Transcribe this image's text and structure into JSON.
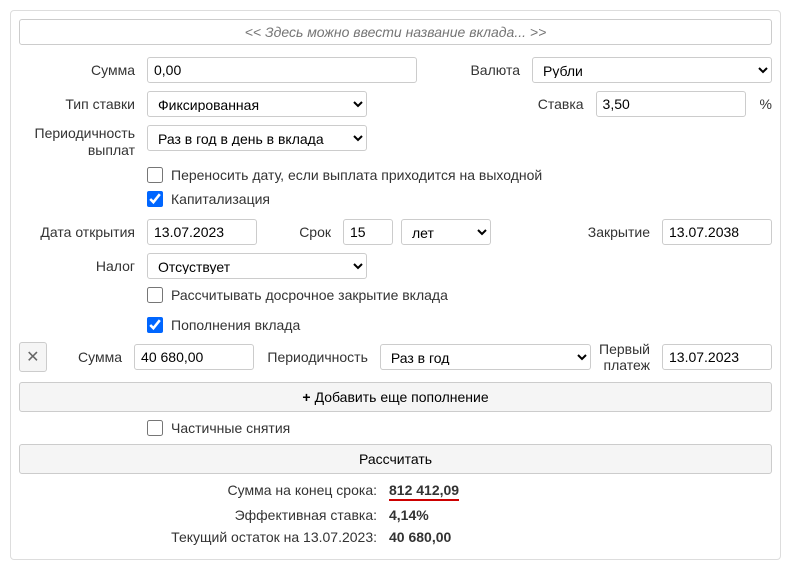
{
  "titlePlaceholder": "<< Здесь можно ввести название вклада... >>",
  "labels": {
    "amount": "Сумма",
    "currency": "Валюта",
    "rateType": "Тип ставки",
    "rate": "Ставка",
    "payoutFreq": "Периодичность выплат",
    "moveDate": "Переносить дату, если выплата приходится на выходной",
    "capitalization": "Капитализация",
    "openDate": "Дата открытия",
    "term": "Срок",
    "closeDate": "Закрытие",
    "tax": "Налог",
    "earlyClose": "Рассчитывать досрочное закрытие вклада",
    "refills": "Пополнения вклада",
    "refillAmount": "Сумма",
    "refillFreq": "Периодичность",
    "firstPayment": "Первый платеж",
    "addRefill": "Добавить еще пополнение",
    "withdrawals": "Частичные снятия",
    "calculate": "Рассчитать",
    "endAmount": "Сумма на конец срока:",
    "effRate": "Эффективная ставка:",
    "currentBalance": "Текущий остаток на 13.07.2023:",
    "pctSign": "%"
  },
  "values": {
    "amount": "0,00",
    "currency": "Рубли",
    "rateType": "Фиксированная",
    "rate": "3,50",
    "payoutFreq": "Раз в год в день в вклада",
    "openDate": "13.07.2023",
    "term": "15",
    "termUnit": "лет",
    "closeDate": "13.07.2038",
    "tax": "Отсуствует",
    "refillAmount": "40 680,00",
    "refillFreq": "Раз в год",
    "firstPaymentDate": "13.07.2023"
  },
  "checkboxes": {
    "moveDate": false,
    "capitalization": true,
    "earlyClose": false,
    "refills": true,
    "withdrawals": false
  },
  "results": {
    "endAmount": "812 412,09",
    "effRate": "4,14%",
    "currentBalance": "40 680,00"
  }
}
